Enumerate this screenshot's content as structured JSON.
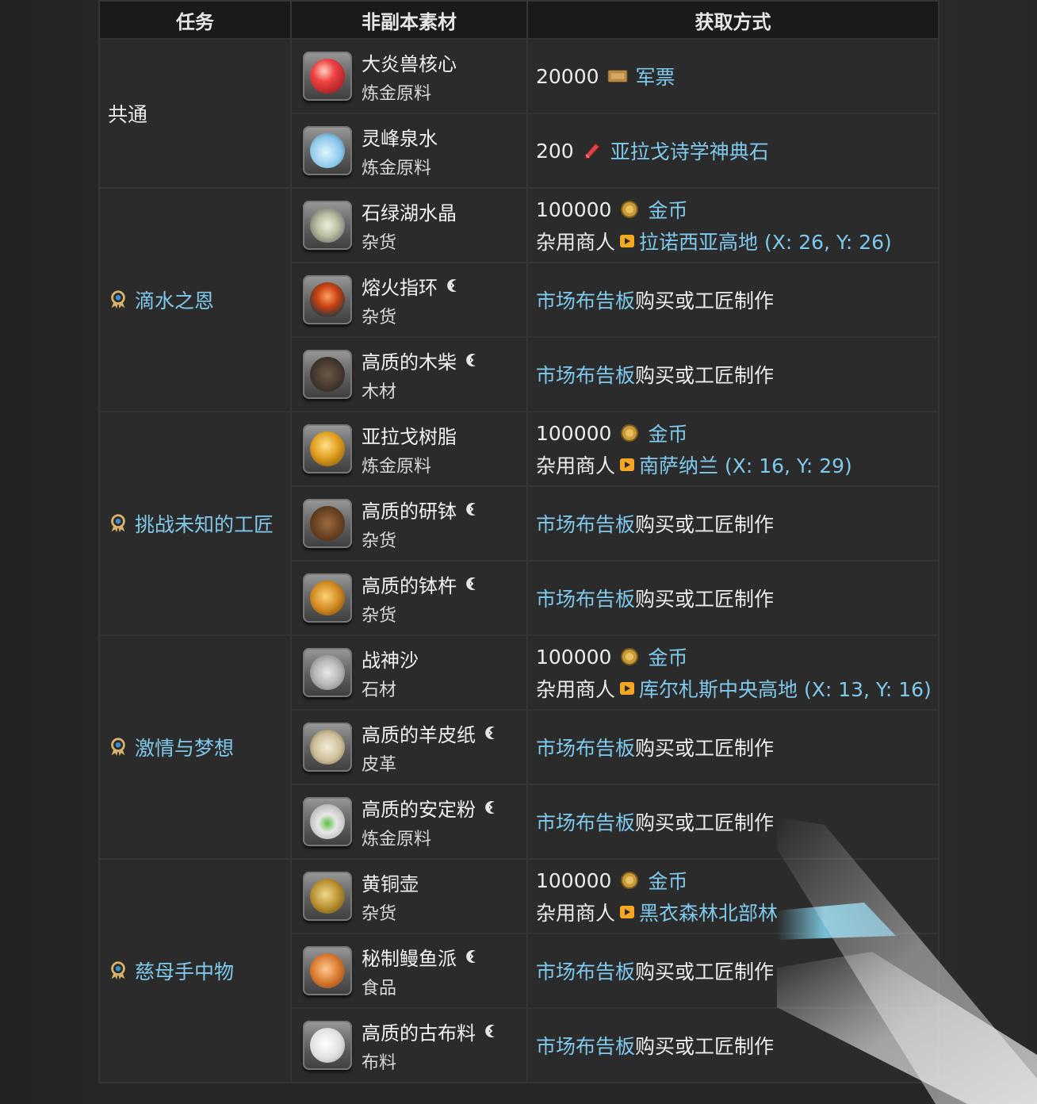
{
  "headers": {
    "quest": "任务",
    "material": "非副本素材",
    "acquisition": "获取方式"
  },
  "colors": {
    "link": "#7fc9ec",
    "text": "#ececec",
    "header_bg": "#1a1a1a",
    "cell_bg": "#2b2b2b"
  },
  "groups": [
    {
      "quest": "共通",
      "quest_is_link": false,
      "items": [
        {
          "name": "大炎兽核心",
          "type": "炼金原料",
          "hq": false,
          "icon": "red-orb-icon",
          "acq": {
            "kind": "currency",
            "amount": "20000",
            "currency": "军票",
            "currency_icon": "military-seal-icon"
          }
        },
        {
          "name": "灵峰泉水",
          "type": "炼金原料",
          "hq": false,
          "icon": "water-bottle-icon",
          "acq": {
            "kind": "currency",
            "amount": "200",
            "currency": "亚拉戈诗学神典石",
            "currency_icon": "poetics-tomestone-icon"
          }
        }
      ]
    },
    {
      "quest": "滴水之恩",
      "quest_is_link": true,
      "items": [
        {
          "name": "石绿湖水晶",
          "type": "杂货",
          "hq": false,
          "icon": "crystal-icon",
          "acq": {
            "kind": "vendor",
            "amount": "100000",
            "currency": "金币",
            "vendor": "杂用商人",
            "location": "拉诺西亚高地 (X: 26, Y: 26)"
          }
        },
        {
          "name": "熔火指环",
          "type": "杂货",
          "hq": true,
          "icon": "fire-ring-icon",
          "acq": {
            "kind": "market",
            "link": "市场布告板",
            "text": "购买或工匠制作"
          }
        },
        {
          "name": "高质的木柴",
          "type": "木材",
          "hq": true,
          "icon": "firewood-icon",
          "acq": {
            "kind": "market",
            "link": "市场布告板",
            "text": "购买或工匠制作"
          }
        }
      ]
    },
    {
      "quest": "挑战未知的工匠",
      "quest_is_link": true,
      "items": [
        {
          "name": "亚拉戈树脂",
          "type": "炼金原料",
          "hq": false,
          "icon": "resin-icon",
          "acq": {
            "kind": "vendor",
            "amount": "100000",
            "currency": "金币",
            "vendor": "杂用商人",
            "location": "南萨纳兰 (X: 16, Y: 29)"
          }
        },
        {
          "name": "高质的研钵",
          "type": "杂货",
          "hq": true,
          "icon": "mortar-icon",
          "acq": {
            "kind": "market",
            "link": "市场布告板",
            "text": "购买或工匠制作"
          }
        },
        {
          "name": "高质的钵杵",
          "type": "杂货",
          "hq": true,
          "icon": "pestle-icon",
          "acq": {
            "kind": "market",
            "link": "市场布告板",
            "text": "购买或工匠制作"
          }
        }
      ]
    },
    {
      "quest": "激情与梦想",
      "quest_is_link": true,
      "items": [
        {
          "name": "战神沙",
          "type": "石材",
          "hq": false,
          "icon": "sand-icon",
          "acq": {
            "kind": "vendor",
            "amount": "100000",
            "currency": "金币",
            "vendor": "杂用商人",
            "location": "库尔札斯中央高地 (X: 13, Y: 16)"
          }
        },
        {
          "name": "高质的羊皮纸",
          "type": "皮革",
          "hq": true,
          "icon": "parchment-icon",
          "acq": {
            "kind": "market",
            "link": "市场布告板",
            "text": "购买或工匠制作"
          }
        },
        {
          "name": "高质的安定粉",
          "type": "炼金原料",
          "hq": true,
          "icon": "powder-icon",
          "acq": {
            "kind": "market",
            "link": "市场布告板",
            "text": "购买或工匠制作"
          }
        }
      ]
    },
    {
      "quest": "慈母手中物",
      "quest_is_link": true,
      "items": [
        {
          "name": "黄铜壶",
          "type": "杂货",
          "hq": false,
          "icon": "brass-kettle-icon",
          "acq": {
            "kind": "vendor",
            "amount": "100000",
            "currency": "金币",
            "vendor": "杂用商人",
            "location": "黑衣森林北部林"
          }
        },
        {
          "name": "秘制鳗鱼派",
          "type": "食品",
          "hq": true,
          "icon": "eel-pie-icon",
          "acq": {
            "kind": "market",
            "link": "市场布告板",
            "text": "购买或工匠制作"
          }
        },
        {
          "name": "高质的古布料",
          "type": "布料",
          "hq": true,
          "icon": "cloth-icon",
          "acq": {
            "kind": "market",
            "link": "市场布告板",
            "text": "购买或工匠制作"
          }
        }
      ]
    }
  ]
}
